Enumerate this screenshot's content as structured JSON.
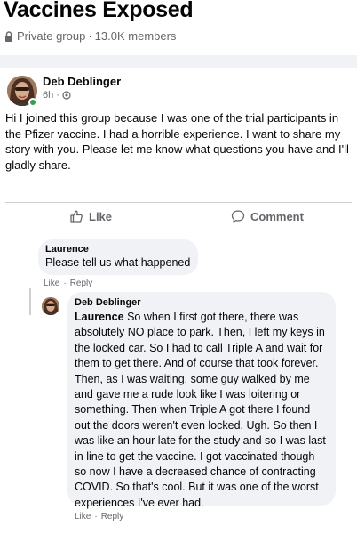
{
  "group": {
    "title": "Vaccines Exposed",
    "privacy": "Private group",
    "members": "13.0K members",
    "meta_separator": "·"
  },
  "post": {
    "author": "Deb Deblinger",
    "time": "6h",
    "meta_separator": "·",
    "text": "Hi I joined this group because I was one of the trial participants in the Pfizer vaccine. I had a horrible experience. I want to share my story with you. Please let me know what questions you have and I'll gladly share.",
    "actions": {
      "like": "Like",
      "comment": "Comment"
    }
  },
  "comments": [
    {
      "author": "Laurence",
      "text": "Please tell us what happened",
      "actions": {
        "like": "Like",
        "separator": "·",
        "reply": "Reply"
      }
    }
  ],
  "reply": {
    "author": "Deb Deblinger",
    "mention": "Laurence",
    "text": "So when I first got there, there was absolutely NO place to park. Then, I left my keys in the locked car. So I had to call Triple A and wait for them to get there. And of course that took forever. Then, as I was waiting, some guy walked by me and gave me a rude look like I was loitering or something. Then when Triple A got there I found out the doors weren't even locked. Ugh. So then I was like an hour late for the study and so I was last in line to get the vaccine. I got vaccinated though so now I have a decreased chance of contracting COVID. So that's cool. But it was one of the worst experiences I've ever had.",
    "actions": {
      "like": "Like",
      "separator": "·",
      "reply": "Reply"
    }
  },
  "colors": {
    "background_band": "#f0f2f5",
    "secondary_text": "#65676b",
    "online_status": "#31a24c"
  },
  "icons": [
    "lock-icon",
    "globe-icon",
    "like-icon",
    "comment-icon",
    "online-status-icon"
  ]
}
